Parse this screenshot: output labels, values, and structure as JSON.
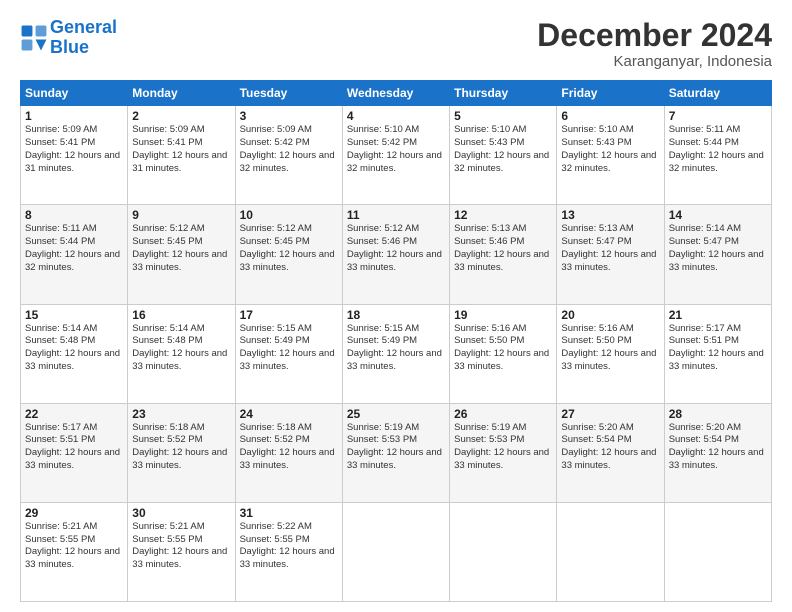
{
  "logo": {
    "line1": "General",
    "line2": "Blue"
  },
  "title": "December 2024",
  "subtitle": "Karanganyar, Indonesia",
  "days_of_week": [
    "Sunday",
    "Monday",
    "Tuesday",
    "Wednesday",
    "Thursday",
    "Friday",
    "Saturday"
  ],
  "weeks": [
    [
      {
        "day": "1",
        "sunrise": "5:09 AM",
        "sunset": "5:41 PM",
        "daylight": "12 hours and 31 minutes."
      },
      {
        "day": "2",
        "sunrise": "5:09 AM",
        "sunset": "5:41 PM",
        "daylight": "12 hours and 31 minutes."
      },
      {
        "day": "3",
        "sunrise": "5:09 AM",
        "sunset": "5:42 PM",
        "daylight": "12 hours and 32 minutes."
      },
      {
        "day": "4",
        "sunrise": "5:10 AM",
        "sunset": "5:42 PM",
        "daylight": "12 hours and 32 minutes."
      },
      {
        "day": "5",
        "sunrise": "5:10 AM",
        "sunset": "5:43 PM",
        "daylight": "12 hours and 32 minutes."
      },
      {
        "day": "6",
        "sunrise": "5:10 AM",
        "sunset": "5:43 PM",
        "daylight": "12 hours and 32 minutes."
      },
      {
        "day": "7",
        "sunrise": "5:11 AM",
        "sunset": "5:44 PM",
        "daylight": "12 hours and 32 minutes."
      }
    ],
    [
      {
        "day": "8",
        "sunrise": "5:11 AM",
        "sunset": "5:44 PM",
        "daylight": "12 hours and 32 minutes."
      },
      {
        "day": "9",
        "sunrise": "5:12 AM",
        "sunset": "5:45 PM",
        "daylight": "12 hours and 33 minutes."
      },
      {
        "day": "10",
        "sunrise": "5:12 AM",
        "sunset": "5:45 PM",
        "daylight": "12 hours and 33 minutes."
      },
      {
        "day": "11",
        "sunrise": "5:12 AM",
        "sunset": "5:46 PM",
        "daylight": "12 hours and 33 minutes."
      },
      {
        "day": "12",
        "sunrise": "5:13 AM",
        "sunset": "5:46 PM",
        "daylight": "12 hours and 33 minutes."
      },
      {
        "day": "13",
        "sunrise": "5:13 AM",
        "sunset": "5:47 PM",
        "daylight": "12 hours and 33 minutes."
      },
      {
        "day": "14",
        "sunrise": "5:14 AM",
        "sunset": "5:47 PM",
        "daylight": "12 hours and 33 minutes."
      }
    ],
    [
      {
        "day": "15",
        "sunrise": "5:14 AM",
        "sunset": "5:48 PM",
        "daylight": "12 hours and 33 minutes."
      },
      {
        "day": "16",
        "sunrise": "5:14 AM",
        "sunset": "5:48 PM",
        "daylight": "12 hours and 33 minutes."
      },
      {
        "day": "17",
        "sunrise": "5:15 AM",
        "sunset": "5:49 PM",
        "daylight": "12 hours and 33 minutes."
      },
      {
        "day": "18",
        "sunrise": "5:15 AM",
        "sunset": "5:49 PM",
        "daylight": "12 hours and 33 minutes."
      },
      {
        "day": "19",
        "sunrise": "5:16 AM",
        "sunset": "5:50 PM",
        "daylight": "12 hours and 33 minutes."
      },
      {
        "day": "20",
        "sunrise": "5:16 AM",
        "sunset": "5:50 PM",
        "daylight": "12 hours and 33 minutes."
      },
      {
        "day": "21",
        "sunrise": "5:17 AM",
        "sunset": "5:51 PM",
        "daylight": "12 hours and 33 minutes."
      }
    ],
    [
      {
        "day": "22",
        "sunrise": "5:17 AM",
        "sunset": "5:51 PM",
        "daylight": "12 hours and 33 minutes."
      },
      {
        "day": "23",
        "sunrise": "5:18 AM",
        "sunset": "5:52 PM",
        "daylight": "12 hours and 33 minutes."
      },
      {
        "day": "24",
        "sunrise": "5:18 AM",
        "sunset": "5:52 PM",
        "daylight": "12 hours and 33 minutes."
      },
      {
        "day": "25",
        "sunrise": "5:19 AM",
        "sunset": "5:53 PM",
        "daylight": "12 hours and 33 minutes."
      },
      {
        "day": "26",
        "sunrise": "5:19 AM",
        "sunset": "5:53 PM",
        "daylight": "12 hours and 33 minutes."
      },
      {
        "day": "27",
        "sunrise": "5:20 AM",
        "sunset": "5:54 PM",
        "daylight": "12 hours and 33 minutes."
      },
      {
        "day": "28",
        "sunrise": "5:20 AM",
        "sunset": "5:54 PM",
        "daylight": "12 hours and 33 minutes."
      }
    ],
    [
      {
        "day": "29",
        "sunrise": "5:21 AM",
        "sunset": "5:55 PM",
        "daylight": "12 hours and 33 minutes."
      },
      {
        "day": "30",
        "sunrise": "5:21 AM",
        "sunset": "5:55 PM",
        "daylight": "12 hours and 33 minutes."
      },
      {
        "day": "31",
        "sunrise": "5:22 AM",
        "sunset": "5:55 PM",
        "daylight": "12 hours and 33 minutes."
      },
      null,
      null,
      null,
      null
    ]
  ]
}
